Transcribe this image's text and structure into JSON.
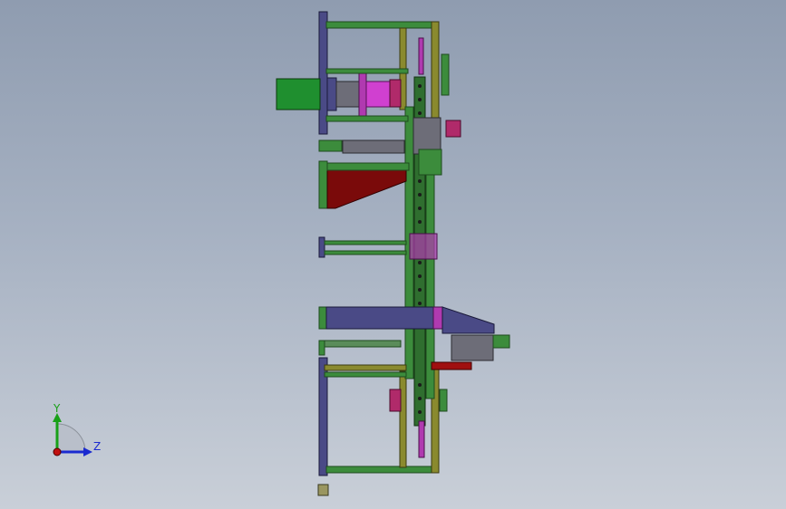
{
  "scene": {
    "background_top": "#8f9cb0",
    "background_bottom": "#c9cfd8",
    "colors": {
      "frame_green": "#3c8c3c",
      "frame_dark": "#1e4a1e",
      "plate_navy": "#4a4a86",
      "bracket_olive": "#8a8a2e",
      "motor_green": "#1f8f2f",
      "magenta": "#b03ab0",
      "wedge_red": "#7a0a0a",
      "steel_gray": "#6d6d78",
      "base_tan": "#9a9660"
    }
  },
  "triad": {
    "axis_y_label": "Y",
    "axis_z_label": "Z",
    "axis_y_color": "#18a018",
    "axis_z_color": "#1a2ad0",
    "origin_color": "#c01010"
  }
}
